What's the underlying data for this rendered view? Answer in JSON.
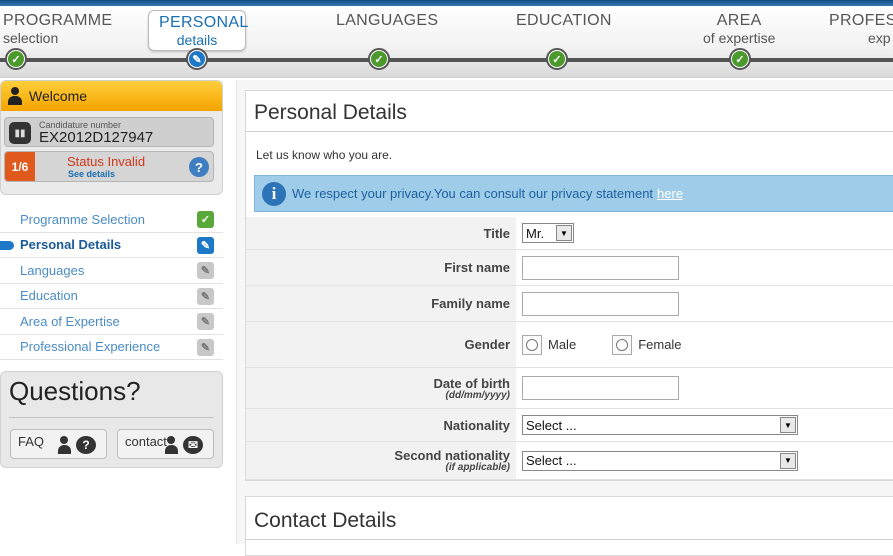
{
  "steps": [
    {
      "title": "PROGRAMME",
      "subtitle": "selection",
      "state": "done"
    },
    {
      "title": "PERSONAL",
      "subtitle": "details",
      "state": "active"
    },
    {
      "title": "LANGUAGES",
      "subtitle": "",
      "state": "done"
    },
    {
      "title": "EDUCATION",
      "subtitle": "",
      "state": "done"
    },
    {
      "title": "AREA",
      "subtitle": "of expertise",
      "state": "done"
    },
    {
      "title": "PROFESS",
      "subtitle": "exp",
      "state": "done"
    }
  ],
  "sidebar": {
    "welcome": "Welcome",
    "candidature_label": "Candidature number",
    "candidature_number": "EX2012D127947",
    "progress": "1/6",
    "status": "Status Invalid",
    "see_details": "See details",
    "help": "?",
    "nav": [
      {
        "label": "Programme Selection",
        "state": "done"
      },
      {
        "label": "Personal Details",
        "state": "active"
      },
      {
        "label": "Languages",
        "state": "locked"
      },
      {
        "label": "Education",
        "state": "locked"
      },
      {
        "label": "Area of Expertise",
        "state": "locked"
      },
      {
        "label": "Professional Experience",
        "state": "locked"
      }
    ],
    "questions_title": "Questions?",
    "faq": "FAQ",
    "contact": "contact"
  },
  "personal": {
    "title": "Personal Details",
    "intro": "Let us know who you are.",
    "privacy_text": "We respect your privacy.You can consult our privacy statement",
    "privacy_link": "here",
    "fields": {
      "title_label": "Title",
      "title_value": "Mr.",
      "first_name_label": "First name",
      "family_name_label": "Family name",
      "gender_label": "Gender",
      "male": "Male",
      "female": "Female",
      "dob_label": "Date of birth",
      "dob_hint": "(dd/mm/yyyy)",
      "nationality_label": "Nationality",
      "nationality_value": "Select ...",
      "second_nationality_label": "Second nationality",
      "second_nationality_hint": "(if applicable)",
      "second_nationality_value": "Select ..."
    }
  },
  "contact_details": {
    "title": "Contact Details"
  },
  "colors": {
    "accent": "#1a6fb5",
    "welcome": "#f5a300",
    "status": "#d2381a",
    "done": "#4b9a2b"
  }
}
